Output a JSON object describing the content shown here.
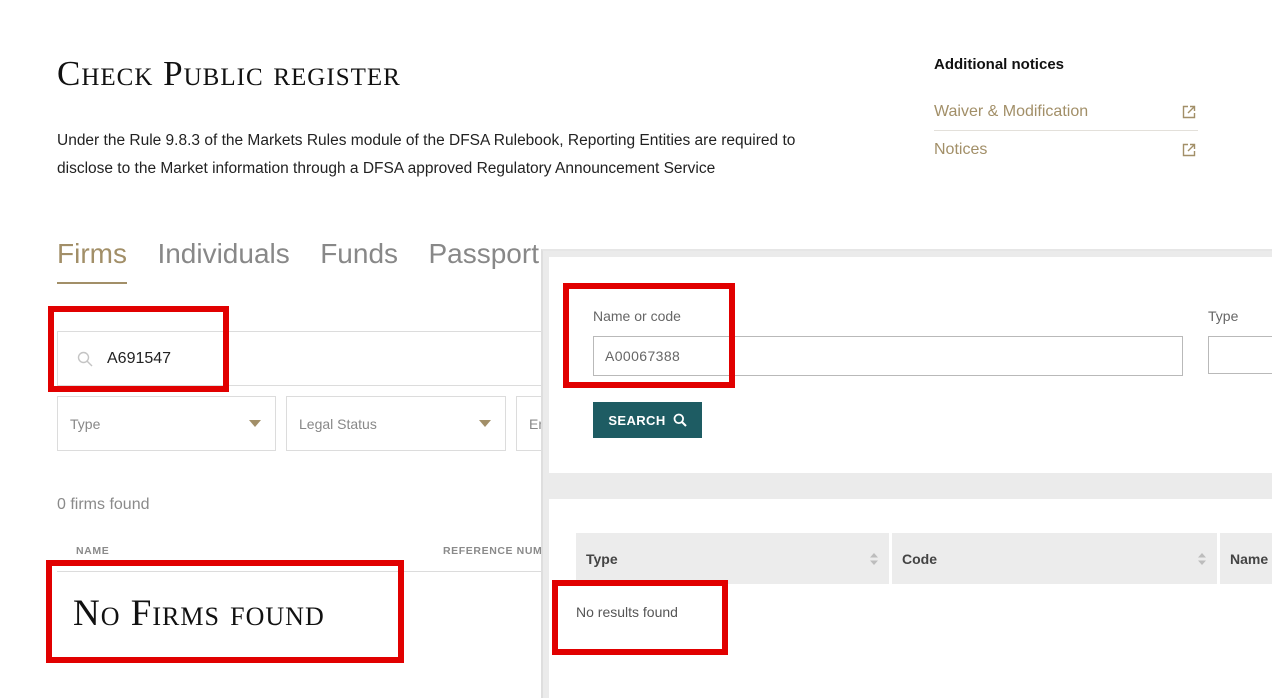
{
  "header": {
    "title": "Check Public register",
    "intro": "Under the Rule 9.8.3 of the Markets Rules module of the DFSA Rulebook, Reporting Entities are required to disclose to the Market information through a DFSA approved Regulatory Announcement Service"
  },
  "notices": {
    "heading": "Additional notices",
    "items": [
      {
        "label": "Waiver & Modification",
        "icon": "external-link-icon"
      },
      {
        "label": "Notices",
        "icon": "external-link-icon"
      }
    ]
  },
  "tabs": [
    {
      "label": "Firms",
      "active": true
    },
    {
      "label": "Individuals",
      "active": false
    },
    {
      "label": "Funds",
      "active": false
    },
    {
      "label": "Passport",
      "active": false
    }
  ],
  "search": {
    "value": "A691547",
    "icon": "search-icon"
  },
  "filters": [
    {
      "label": "Type"
    },
    {
      "label": "Legal Status"
    },
    {
      "label": "En"
    }
  ],
  "results": {
    "count_text": "0 firms found",
    "columns": [
      "NAME",
      "REFERENCE NUM"
    ],
    "empty_text": "No Firms found"
  },
  "overlay": {
    "name_label": "Name or code",
    "name_value": "A00067388",
    "type_label": "Type",
    "search_button": "SEARCH",
    "columns": [
      "Type",
      "Code",
      "Name"
    ],
    "empty_text": "No results found"
  },
  "colors": {
    "accent_gold": "#a28f68",
    "button_teal": "#1e5c63",
    "annotation_red": "#e10000"
  }
}
